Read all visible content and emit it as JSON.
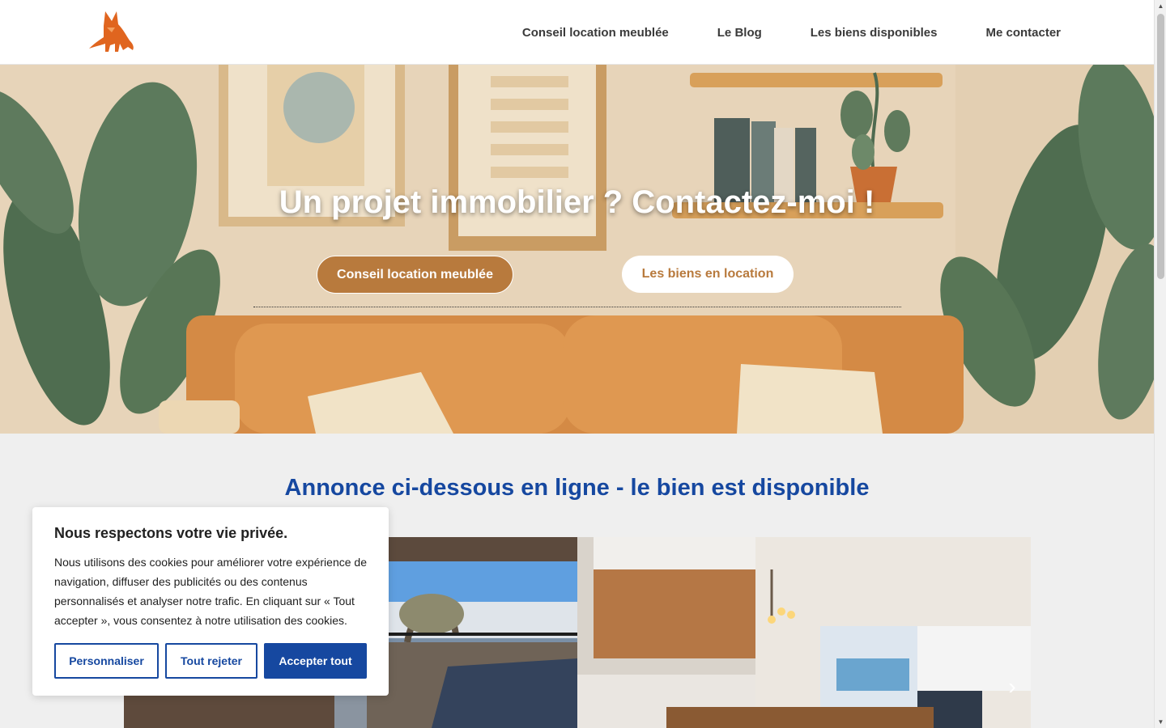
{
  "header": {
    "logo_alt": "fox logo",
    "nav": [
      {
        "label": "Conseil location meublée"
      },
      {
        "label": "Le Blog"
      },
      {
        "label": "Les biens disponibles"
      },
      {
        "label": "Me contacter"
      }
    ]
  },
  "hero": {
    "title": "Un projet immobilier ? Contactez-moi !",
    "primary_button": "Conseil location meublée",
    "secondary_button": "Les biens en location"
  },
  "main": {
    "section_title": "Annonce ci-dessous en ligne - le bien est disponible",
    "carousel": {
      "next_icon": "chevron-right-icon",
      "slides": [
        {
          "subject": "terrace"
        },
        {
          "subject": "kitchen"
        }
      ]
    }
  },
  "cookie_banner": {
    "title": "Nous respectons votre vie privée.",
    "text": "Nous utilisons des cookies pour améliorer votre expérience de navigation, diffuser des publicités ou des contenus personnalisés et analyser notre trafic. En cliquant sur « Tout accepter », vous consentez à notre utilisation des cookies.",
    "customize_label": "Personnaliser",
    "reject_label": "Tout rejeter",
    "accept_label": "Accepter tout"
  },
  "colors": {
    "accent_brown": "#b87a3d",
    "primary_blue": "#1648a0"
  }
}
